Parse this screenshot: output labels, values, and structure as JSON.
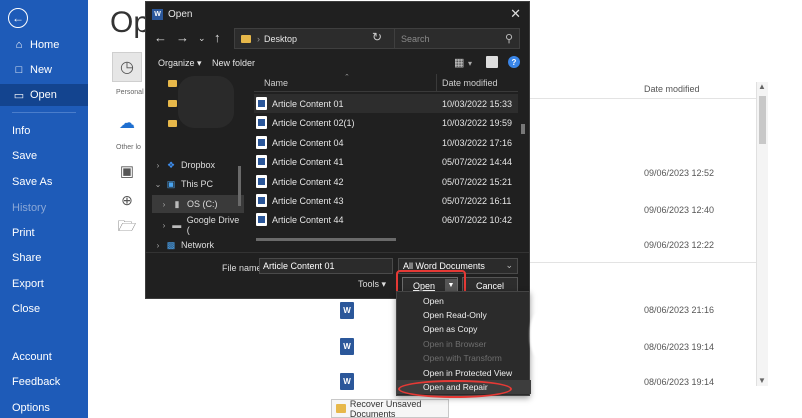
{
  "backstage": {
    "title": "Op",
    "nav": {
      "home": "Home",
      "new": "New",
      "open": "Open",
      "info": "Info",
      "save": "Save",
      "save_as": "Save As",
      "history": "History",
      "print": "Print",
      "share": "Share",
      "export": "Export",
      "close": "Close",
      "account": "Account",
      "feedback": "Feedback",
      "options": "Options"
    },
    "section_personal": "Personal",
    "section_other": "Other lo",
    "column_date_modified": "Date modified",
    "recent_dates": [
      "09/06/2023 12:52",
      "09/06/2023 12:40",
      "09/06/2023 12:22",
      "08/06/2023 21:16",
      "08/06/2023 19:14",
      "08/06/2023 19:14"
    ],
    "recover_button": "Recover Unsaved Documents",
    "colors": {
      "sidebar": "#1e5bb8",
      "sidebar_active": "#13448f"
    }
  },
  "dialog": {
    "title": "Open",
    "address": "Desktop",
    "search_placeholder": "Search",
    "organize": "Organize",
    "new_folder": "New folder",
    "nav_pane": {
      "dropbox": "Dropbox",
      "this_pc": "This PC",
      "os_c": "OS (C:)",
      "google_drive": "Google Drive (",
      "network": "Network"
    },
    "columns": {
      "name": "Name",
      "date_modified": "Date modified"
    },
    "files": [
      {
        "name": "Article Content 01",
        "date": "10/03/2022 15:33"
      },
      {
        "name": "Article Content 02(1)",
        "date": "10/03/2022 19:59"
      },
      {
        "name": "Article Content 04",
        "date": "10/03/2022 17:16"
      },
      {
        "name": "Article Content 41",
        "date": "05/07/2022 14:44"
      },
      {
        "name": "Article Content 42",
        "date": "05/07/2022 15:21"
      },
      {
        "name": "Article Content 43",
        "date": "05/07/2022 16:11"
      },
      {
        "name": "Article Content 44",
        "date": "06/07/2022 10:42"
      }
    ],
    "file_name_label": "File name:",
    "file_name_value": "Article Content 01",
    "file_type": "All Word Documents",
    "tools": "Tools",
    "open_button": "Open",
    "cancel_button": "Cancel",
    "open_menu": [
      {
        "label": "Open",
        "enabled": true
      },
      {
        "label": "Open Read-Only",
        "enabled": true
      },
      {
        "label": "Open as Copy",
        "enabled": true
      },
      {
        "label": "Open in Browser",
        "enabled": false
      },
      {
        "label": "Open with Transform",
        "enabled": false
      },
      {
        "label": "Open in Protected View",
        "enabled": true
      },
      {
        "label": "Open and Repair",
        "enabled": true
      }
    ],
    "colors": {
      "background": "#202020",
      "highlight_ring": "#e53935"
    }
  }
}
